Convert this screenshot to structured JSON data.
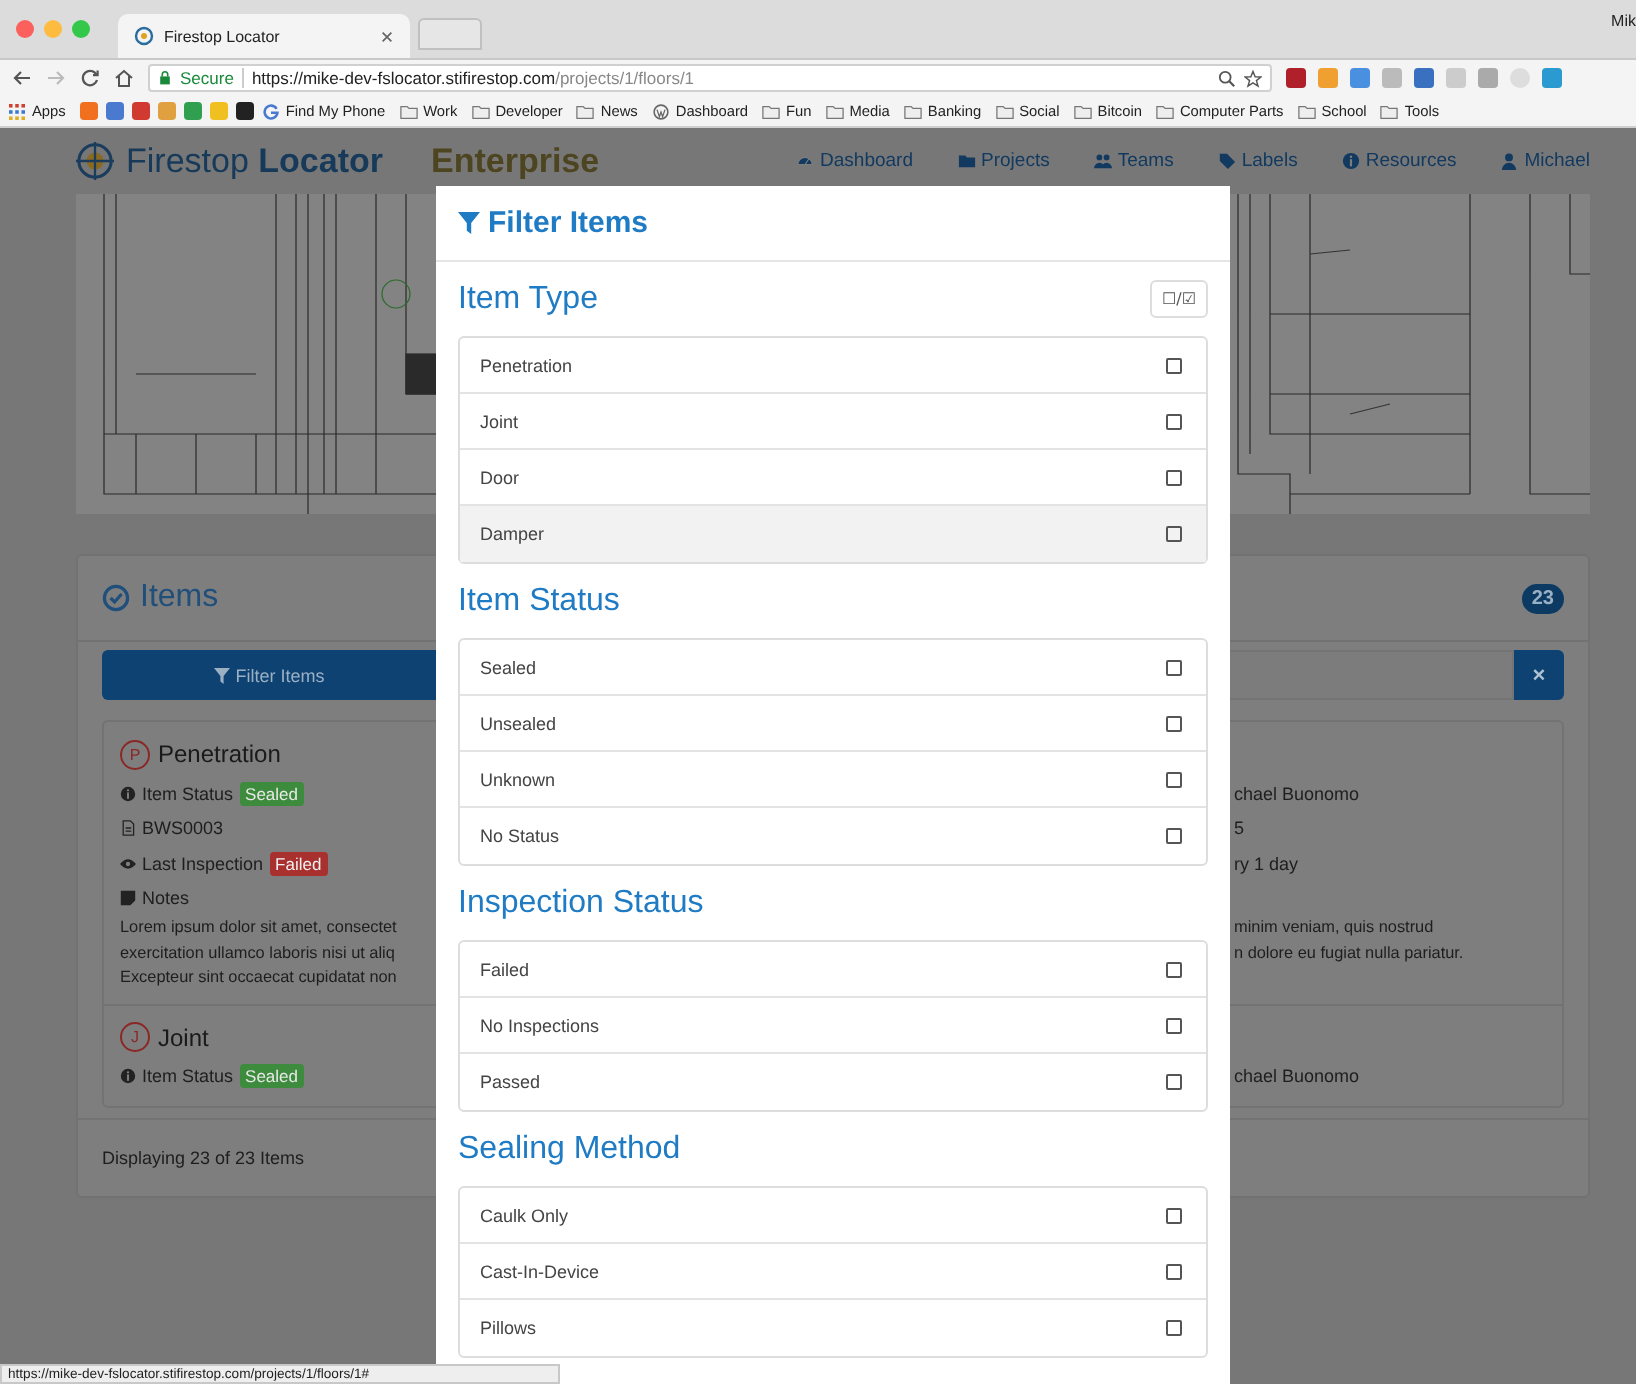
{
  "browser": {
    "tab_title": "Firestop Locator",
    "profile": "Mik",
    "secure_label": "Secure",
    "url_host": "https://mike-dev-fslocator.stifirestop.com",
    "url_path": "/projects/1/floors/1",
    "bookmarks": [
      {
        "label": "Apps",
        "kind": "apps"
      },
      {
        "label": "Find My Phone",
        "kind": "google"
      },
      {
        "label": "Work",
        "kind": "folder"
      },
      {
        "label": "Developer",
        "kind": "folder"
      },
      {
        "label": "News",
        "kind": "folder"
      },
      {
        "label": "Dashboard",
        "kind": "wordpress"
      },
      {
        "label": "Fun",
        "kind": "folder"
      },
      {
        "label": "Media",
        "kind": "folder"
      },
      {
        "label": "Banking",
        "kind": "folder"
      },
      {
        "label": "Social",
        "kind": "folder"
      },
      {
        "label": "Bitcoin",
        "kind": "folder"
      },
      {
        "label": "Computer Parts",
        "kind": "folder"
      },
      {
        "label": "School",
        "kind": "folder"
      },
      {
        "label": "Tools",
        "kind": "folder"
      }
    ],
    "status_url": "https://mike-dev-fslocator.stifirestop.com/projects/1/floors/1#"
  },
  "navbar": {
    "brand_light": "Firestop",
    "brand_bold": "Locator",
    "edition": "Enterprise",
    "links": [
      {
        "label": "Dashboard",
        "kind": "dashboard"
      },
      {
        "label": "Projects",
        "kind": "folder"
      },
      {
        "label": "Teams",
        "kind": "users"
      },
      {
        "label": "Labels",
        "kind": "tag"
      },
      {
        "label": "Resources",
        "kind": "info"
      },
      {
        "label": "Michael",
        "kind": "user"
      }
    ]
  },
  "items_panel": {
    "title": "Items",
    "count": "23",
    "filter_button": "Filter Items",
    "clear_button": "×",
    "items": [
      {
        "letter": "P",
        "name": "Penetration",
        "status_label": "Item Status",
        "status": {
          "text": "Sealed",
          "color": "#3d8b3d"
        },
        "code": "BWS0003",
        "inspection_label": "Last Inspection",
        "inspection": {
          "text": "Failed",
          "color": "#a8302e"
        },
        "notes_label": "Notes",
        "notes_left": [
          "Lorem ipsum dolor sit amet, consectet",
          "exercitation ullamco laboris nisi ut aliq",
          "Excepteur sint occaecat cupidatat non"
        ],
        "right_lines": [
          "chael Buonomo",
          "5",
          "ry 1 day"
        ],
        "notes_right": [
          "minim veniam, quis nostrud",
          "n dolore eu fugiat nulla pariatur."
        ]
      },
      {
        "letter": "J",
        "name": "Joint",
        "status_label": "Item Status",
        "status": {
          "text": "Sealed",
          "color": "#3d8b3d"
        },
        "right_lines": [
          "chael Buonomo"
        ]
      }
    ],
    "footer": "Displaying 23 of 23 Items"
  },
  "modal": {
    "title": "Filter Items",
    "toggle_all": "☐/☑",
    "sections": [
      {
        "title": "Item Type",
        "toggle": true,
        "options": [
          {
            "label": "Penetration",
            "checked": false,
            "highlighted": false
          },
          {
            "label": "Joint",
            "checked": false,
            "highlighted": false
          },
          {
            "label": "Door",
            "checked": false,
            "highlighted": false
          },
          {
            "label": "Damper",
            "checked": false,
            "highlighted": true
          }
        ]
      },
      {
        "title": "Item Status",
        "toggle": false,
        "options": [
          {
            "label": "Sealed",
            "checked": false,
            "highlighted": false
          },
          {
            "label": "Unsealed",
            "checked": false,
            "highlighted": false
          },
          {
            "label": "Unknown",
            "checked": false,
            "highlighted": false
          },
          {
            "label": "No Status",
            "checked": false,
            "highlighted": false
          }
        ]
      },
      {
        "title": "Inspection Status",
        "toggle": false,
        "options": [
          {
            "label": "Failed",
            "checked": false,
            "highlighted": false
          },
          {
            "label": "No Inspections",
            "checked": false,
            "highlighted": false
          },
          {
            "label": "Passed",
            "checked": false,
            "highlighted": false
          }
        ]
      },
      {
        "title": "Sealing Method",
        "toggle": false,
        "options": [
          {
            "label": "Caulk Only",
            "checked": false,
            "highlighted": false
          },
          {
            "label": "Cast-In-Device",
            "checked": false,
            "highlighted": false
          },
          {
            "label": "Pillows",
            "checked": false,
            "highlighted": false
          }
        ]
      }
    ]
  }
}
